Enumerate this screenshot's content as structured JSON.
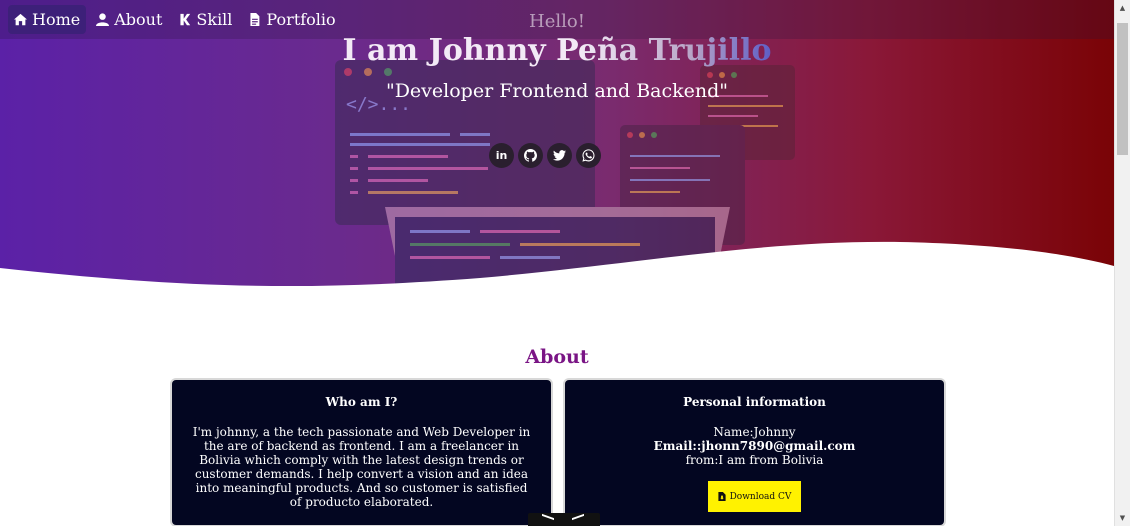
{
  "nav": {
    "items": [
      {
        "label": "Home",
        "icon": "home-icon",
        "active": true
      },
      {
        "label": "About",
        "icon": "user-icon",
        "active": false
      },
      {
        "label": "Skill",
        "icon": "k-icon",
        "active": false
      },
      {
        "label": "Portfolio",
        "icon": "file-icon",
        "active": false
      }
    ]
  },
  "hero": {
    "greeting": "Hello!",
    "title": "I am Johnny Peña Trujillo",
    "subtitle": "\"Developer Frontend and Backend\"",
    "social": [
      {
        "icon": "linkedin-icon",
        "glyph": "in"
      },
      {
        "icon": "github-icon"
      },
      {
        "icon": "twitter-icon"
      },
      {
        "icon": "whatsapp-icon"
      }
    ]
  },
  "about": {
    "title": "About",
    "who": {
      "heading": "Who am I?",
      "text": "I'm johnny, a the tech passionate and Web Developer in the are of backend as frontend. I am a freelancer in Bolivia which comply with the latest design trends or customer demands. I help convert a vision and an idea into meaningful products. And so customer is satisfied of producto elaborated."
    },
    "personal": {
      "heading": "Personal information",
      "name": "Name:Johnny",
      "email": "Email::jhonn7890@gmail.com",
      "from": "from:I am from Bolivia",
      "cv_label": "Download CV"
    }
  },
  "colors": {
    "hero_start": "#5b21a7",
    "hero_end": "#7a0306",
    "about_title": "#7a1585",
    "card_bg": "#030621",
    "cv_button": "#fff200",
    "nav_active": "#3d2079"
  }
}
